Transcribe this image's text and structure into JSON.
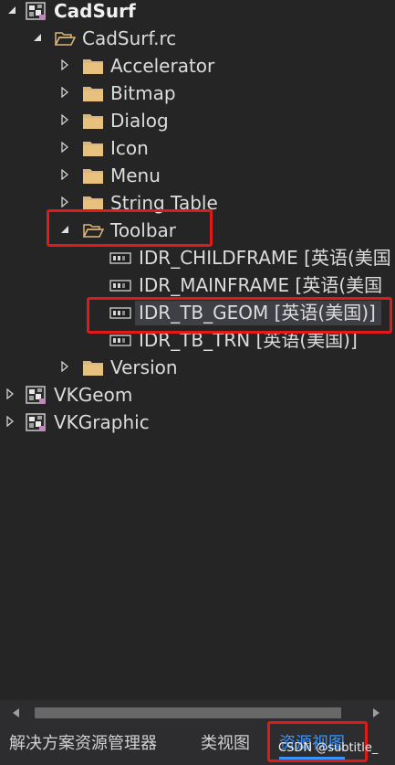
{
  "tree": {
    "root": {
      "label": "CadSurf"
    },
    "rc": {
      "label": "CadSurf.rc"
    },
    "folders": {
      "accelerator": "Accelerator",
      "bitmap": "Bitmap",
      "dialog": "Dialog",
      "icon": "Icon",
      "menu": "Menu",
      "string_table": "String Table",
      "toolbar": "Toolbar",
      "version": "Version"
    },
    "toolbar_items": [
      {
        "id": "IDR_CHILDFRAME",
        "lang": "[英语(美国"
      },
      {
        "id": "IDR_MAINFRAME",
        "lang": "[英语(美国"
      },
      {
        "id": "IDR_TB_GEOM",
        "lang": "[英语(美国)]"
      },
      {
        "id": "IDR_TB_TRN",
        "lang": "[英语(美国)]"
      }
    ],
    "projects": [
      {
        "label": "VKGeom"
      },
      {
        "label": "VKGraphic"
      }
    ]
  },
  "tabs": {
    "solution_explorer": "解决方案资源管理器",
    "class_view": "类视图",
    "resource_view": "资源视图"
  },
  "watermark": "CSDN @subtitle_",
  "colors": {
    "background": "#252526",
    "highlight": "#e01919",
    "active_tab": "#3794ff",
    "folder": "#dcb67a"
  }
}
